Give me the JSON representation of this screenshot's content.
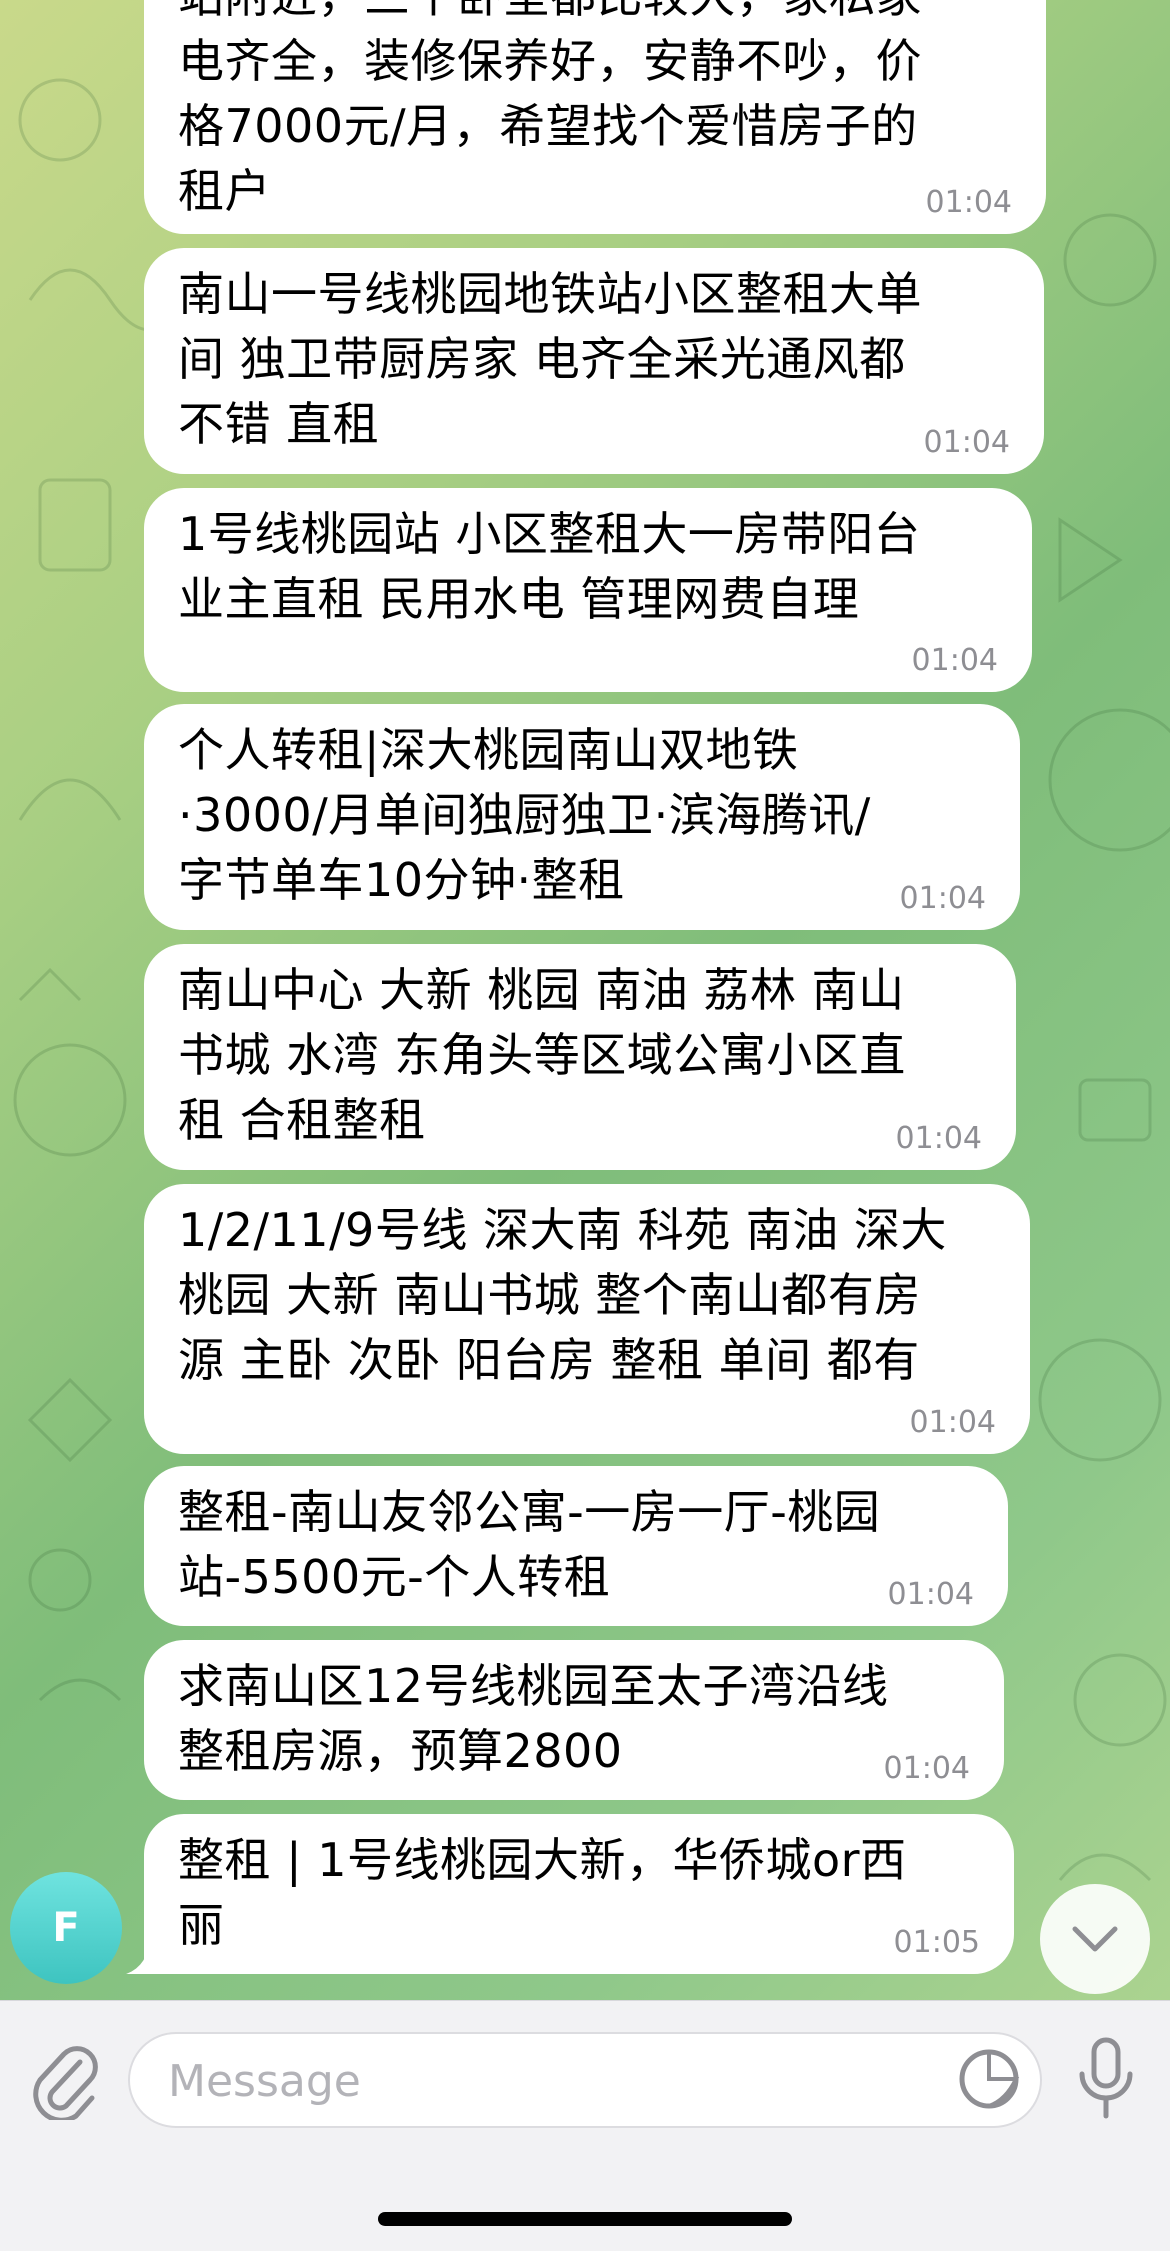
{
  "messages": [
    {
      "text": "站附近，三个卧室都比较大，家私家\n电齐全，装修保养好，安静不吵，价\n格7000元/月，希望找个爱惜房子的\n租户",
      "time": "01:04"
    },
    {
      "text": "南山一号线桃园地铁站小区整租大单\n间 独卫带厨房家 电齐全采光通风都\n不错 直租",
      "time": "01:04"
    },
    {
      "text": "1号线桃园站 小区整租大一房带阳台\n业主直租 民用水电 管理网费自理",
      "time": "01:04"
    },
    {
      "text": "个人转租|深大桃园南山双地铁\n·3000/月单间独厨独卫·滨海腾讯/\n字节单车10分钟·整租",
      "time": "01:04"
    },
    {
      "text": "南山中心 大新 桃园 南油 荔林 南山\n书城 水湾 东角头等区域公寓小区直\n租 合租整租",
      "time": "01:04"
    },
    {
      "text": "1/2/11/9号线 深大南 科苑 南油 深大\n桃园 大新 南山书城 整个南山都有房\n源 主卧 次卧 阳台房 整租 单间 都有",
      "time": "01:04"
    },
    {
      "text": "整租-南山友邻公寓-一房一厅-桃园\n站-5500元-个人转租",
      "time": "01:04"
    },
    {
      "text": "求南山区12号线桃园至太子湾沿线\n整租房源，预算2800",
      "time": "01:04"
    },
    {
      "text": "整租 | 1号线桃园大新，华侨城or西\n丽",
      "time": "01:05"
    }
  ],
  "sender": {
    "initial": "F"
  },
  "composer": {
    "placeholder": "Message"
  },
  "icons": {
    "attach": "paperclip-icon",
    "sticker": "sticker-icon",
    "mic": "microphone-icon",
    "scroll": "chevron-down-icon"
  },
  "colors": {
    "bubble": "#ffffff",
    "avatar": "#4fd1cc",
    "time": "#8e8e93"
  }
}
